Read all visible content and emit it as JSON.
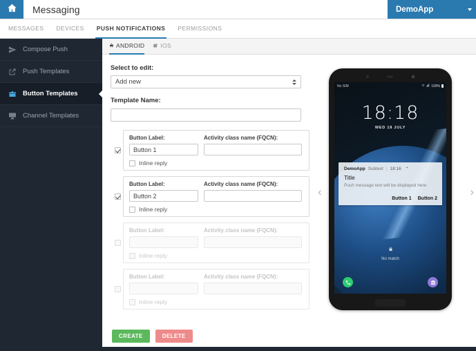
{
  "topbar": {
    "home_icon": "home-icon",
    "title": "Messaging",
    "account_label": "DemoApp"
  },
  "navtabs": [
    {
      "label": "MESSAGES",
      "active": false
    },
    {
      "label": "DEVICES",
      "active": false
    },
    {
      "label": "PUSH NOTIFICATIONS",
      "active": true
    },
    {
      "label": "PERMISSIONS",
      "active": false
    }
  ],
  "sidebar": {
    "items": [
      {
        "label": "Compose Push",
        "icon": "compose-icon",
        "active": false
      },
      {
        "label": "Push Templates",
        "icon": "share-icon",
        "active": false
      },
      {
        "label": "Button Templates",
        "icon": "package-icon",
        "active": true
      },
      {
        "label": "Channel Templates",
        "icon": "monitor-icon",
        "active": false
      }
    ]
  },
  "platform_tabs": [
    {
      "label": "ANDROID",
      "icon": "android-icon",
      "active": true
    },
    {
      "label": "IOS",
      "icon": "apple-icon",
      "active": false
    }
  ],
  "form": {
    "select_label": "Select to edit:",
    "select_value": "Add new",
    "name_label": "Template Name:",
    "name_value": "",
    "name_placeholder": ""
  },
  "button_rows": [
    {
      "enabled": true,
      "checked": true,
      "label_caption": "Button Label:",
      "label_value": "Button 1",
      "fqcn_caption": "Activity class name (FQCN):",
      "fqcn_value": "",
      "inline_reply_label": "Inline reply",
      "inline_reply_checked": false
    },
    {
      "enabled": true,
      "checked": true,
      "label_caption": "Button Label:",
      "label_value": "Button 2",
      "fqcn_caption": "Activity class name (FQCN):",
      "fqcn_value": "",
      "inline_reply_label": "Inline reply",
      "inline_reply_checked": false
    },
    {
      "enabled": false,
      "checked": false,
      "label_caption": "Button Label:",
      "label_value": "",
      "fqcn_caption": "Activity class name (FQCN):",
      "fqcn_value": "",
      "inline_reply_label": "Inline reply",
      "inline_reply_checked": false
    },
    {
      "enabled": false,
      "checked": false,
      "label_caption": "Button Label:",
      "label_value": "",
      "fqcn_caption": "Activity class name (FQCN):",
      "fqcn_value": "",
      "inline_reply_label": "Inline reply",
      "inline_reply_checked": false
    }
  ],
  "actions": {
    "create_label": "CREATE",
    "delete_label": "DELETE"
  },
  "preview": {
    "prev_arrow": "‹",
    "next_arrow": "›",
    "phone": {
      "statusbar": {
        "carrier": "No SIM",
        "battery": "100%"
      },
      "lockscreen": {
        "time": "18:18",
        "date": "WED 18 JULY",
        "lock_text": "No match"
      },
      "notification": {
        "app_name": "DemoApp",
        "subtext": "Subtext",
        "divider": "|",
        "time": "18:16",
        "expand_caret": "⌃",
        "title": "Title",
        "body": "Push message text will be displayed here",
        "buttons": [
          "Button 1",
          "Button 2"
        ]
      }
    }
  },
  "colors": {
    "accent": "#2a7ab0",
    "sidebar_bg": "#1f2733",
    "create_green": "#5cb85c",
    "delete_red": "#ef8a8a"
  }
}
